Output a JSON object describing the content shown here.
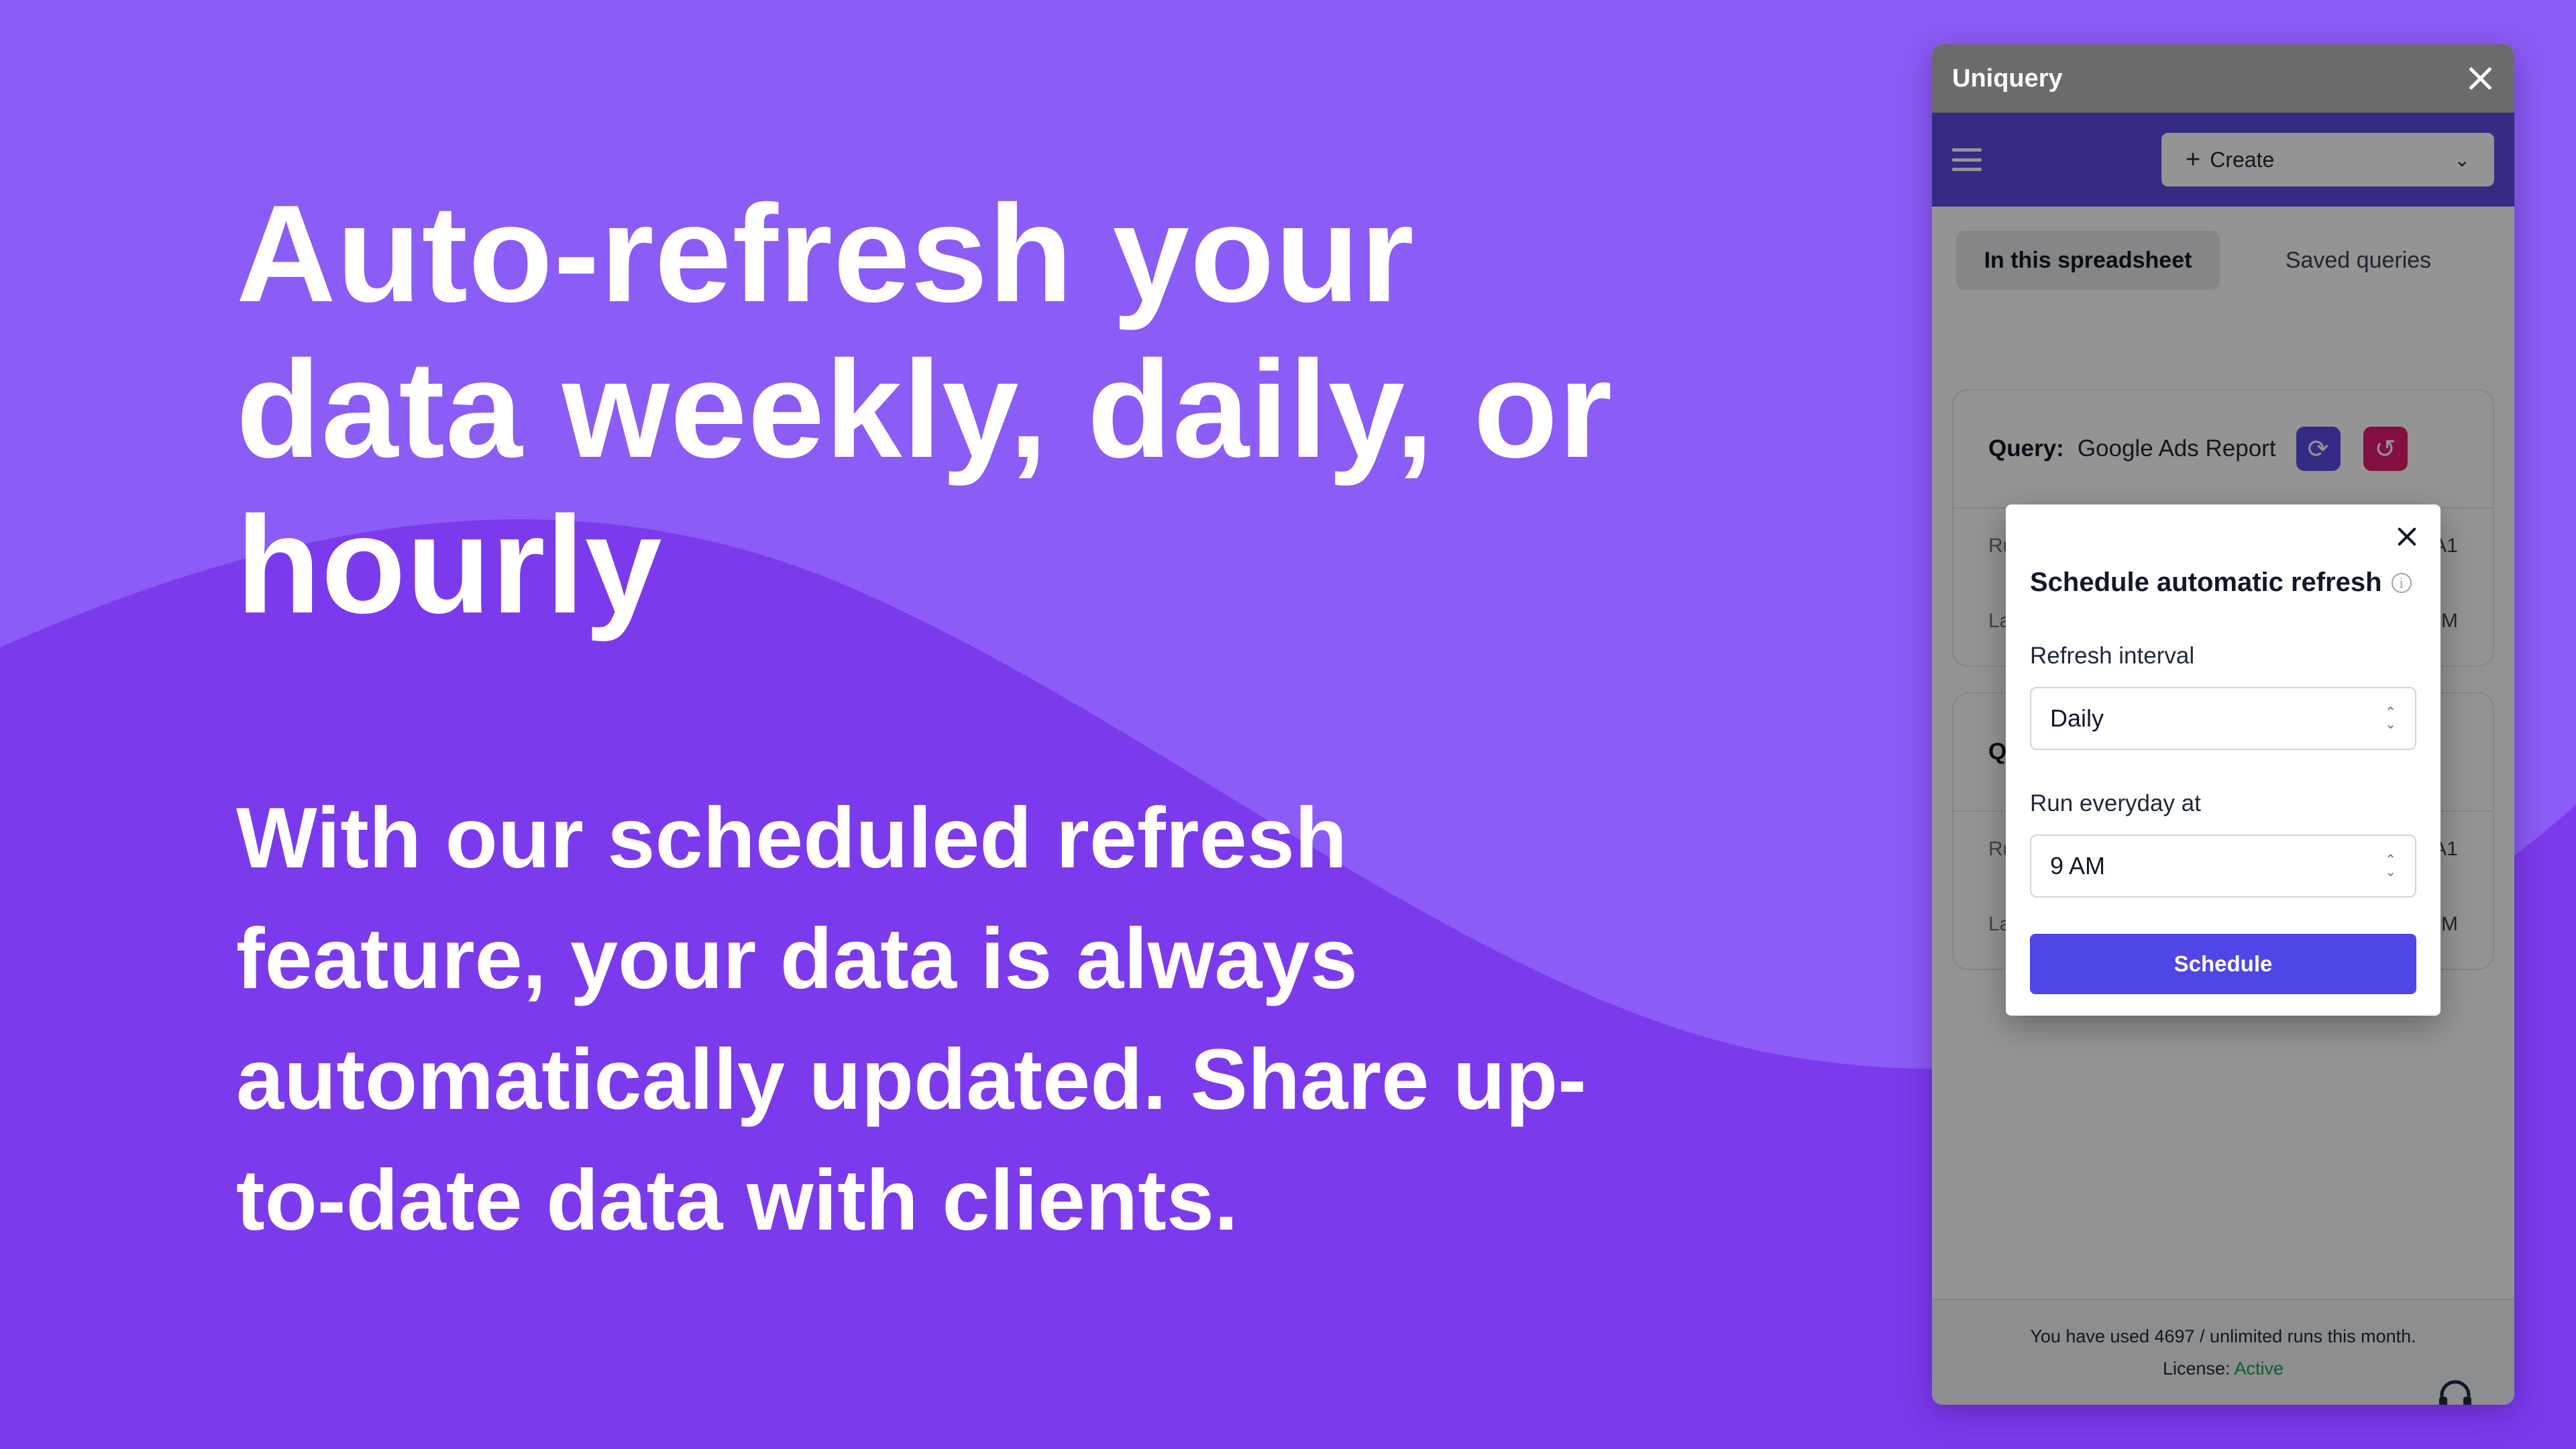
{
  "marketing": {
    "headline": "Auto-refresh your data weekly, daily, or hourly",
    "subtext": "With our scheduled refresh feature, your data is always automatically updated. Share up-to-date data with clients."
  },
  "colors": {
    "background": "#8b5cf6",
    "wave": "#7c3aed",
    "toolbar": "#5b4be6",
    "primary_button": "#4f46e5",
    "schedule_icon": "#e11d72",
    "license_active": "#16a34a"
  },
  "panel": {
    "title": "Uniquery",
    "create_label": "Create",
    "tabs": [
      {
        "label": "In this spreadsheet",
        "active": true
      },
      {
        "label": "Saved queries",
        "active": false
      }
    ],
    "cards": [
      {
        "query_label": "Query:",
        "query_name": "Google Ads Report",
        "rows": [
          {
            "label": "Ru",
            "value": "A1"
          },
          {
            "label": "La",
            "value": "M"
          }
        ]
      },
      {
        "query_label": "Q",
        "rows": [
          {
            "label": "Ru",
            "value": "A1"
          },
          {
            "label": "La",
            "value": "M"
          }
        ]
      }
    ],
    "footer": {
      "usage_text": "You have used 4697 / unlimited runs this month.",
      "license_label": "License:",
      "license_status": "Active"
    },
    "icons": [
      "menu-icon",
      "plus-icon",
      "chevron-down-icon",
      "close-icon",
      "refresh-icon",
      "clock-history-icon",
      "headset-icon"
    ]
  },
  "modal": {
    "title": "Schedule automatic refresh",
    "interval_label": "Refresh interval",
    "interval_value": "Daily",
    "time_label": "Run everyday at",
    "time_value": "9 AM",
    "submit_label": "Schedule"
  }
}
